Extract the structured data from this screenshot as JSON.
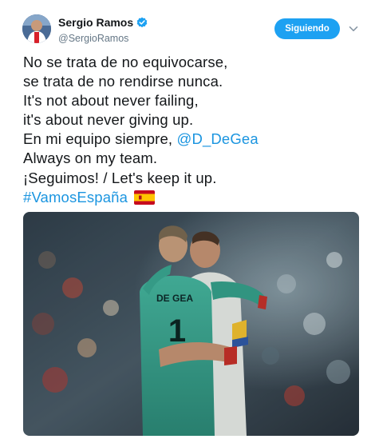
{
  "author": {
    "display_name": "Sergio Ramos",
    "handle": "@SergioRamos",
    "verified": true
  },
  "follow_button": {
    "label": "Siguiendo"
  },
  "tweet": {
    "lines": [
      "No se trata de no equivocarse,",
      "se trata de no rendirse nunca.",
      "It's not about never failing,",
      "it's about never giving up."
    ],
    "mention_line_prefix": "En mi equipo siempre, ",
    "mention": "@D_DeGea",
    "line6": "Always on my team.",
    "line7": "¡Seguimos! / Let's keep it up.",
    "hashtag": "#VamosEspaña",
    "flag_icon": "spain-flag-icon"
  },
  "media": {
    "jersey_name": "DE GEA",
    "jersey_number": "1"
  },
  "colors": {
    "link": "#1b95e0",
    "follow_bg": "#1da1f2",
    "secondary_text": "#657786"
  }
}
